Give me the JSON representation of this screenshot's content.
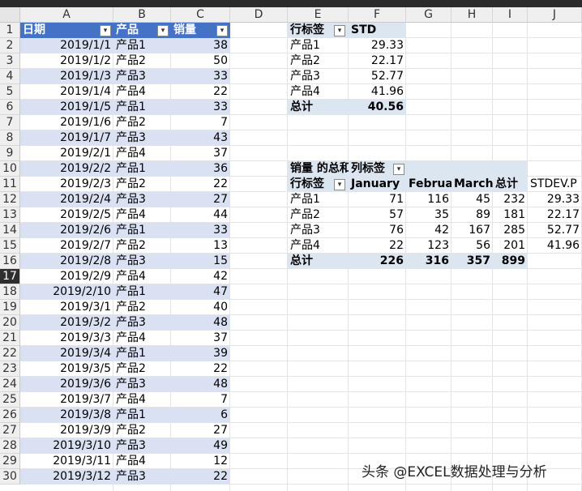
{
  "columns": [
    "A",
    "B",
    "C",
    "D",
    "E",
    "F",
    "G",
    "H",
    "I",
    "J"
  ],
  "rows": [
    "1",
    "2",
    "3",
    "4",
    "5",
    "6",
    "7",
    "8",
    "9",
    "10",
    "11",
    "12",
    "13",
    "14",
    "15",
    "16",
    "17",
    "18",
    "19",
    "20",
    "21",
    "22",
    "23",
    "24",
    "25",
    "26",
    "27",
    "28",
    "29",
    "30"
  ],
  "selected_row": "17",
  "table": {
    "headers": [
      "日期",
      "产品",
      "销量"
    ],
    "rows": [
      [
        "2019/1/1",
        "产品1",
        "38"
      ],
      [
        "2019/1/2",
        "产品2",
        "50"
      ],
      [
        "2019/1/3",
        "产品3",
        "33"
      ],
      [
        "2019/1/4",
        "产品4",
        "22"
      ],
      [
        "2019/1/5",
        "产品1",
        "33"
      ],
      [
        "2019/1/6",
        "产品2",
        "7"
      ],
      [
        "2019/1/7",
        "产品3",
        "43"
      ],
      [
        "2019/2/1",
        "产品4",
        "37"
      ],
      [
        "2019/2/2",
        "产品1",
        "36"
      ],
      [
        "2019/2/3",
        "产品2",
        "22"
      ],
      [
        "2019/2/4",
        "产品3",
        "27"
      ],
      [
        "2019/2/5",
        "产品4",
        "44"
      ],
      [
        "2019/2/6",
        "产品1",
        "33"
      ],
      [
        "2019/2/7",
        "产品2",
        "13"
      ],
      [
        "2019/2/8",
        "产品3",
        "15"
      ],
      [
        "2019/2/9",
        "产品4",
        "42"
      ],
      [
        "2019/2/10",
        "产品1",
        "47"
      ],
      [
        "2019/3/1",
        "产品2",
        "40"
      ],
      [
        "2019/3/2",
        "产品3",
        "48"
      ],
      [
        "2019/3/3",
        "产品4",
        "37"
      ],
      [
        "2019/3/4",
        "产品1",
        "39"
      ],
      [
        "2019/3/5",
        "产品2",
        "22"
      ],
      [
        "2019/3/6",
        "产品3",
        "48"
      ],
      [
        "2019/3/7",
        "产品4",
        "7"
      ],
      [
        "2019/3/8",
        "产品1",
        "6"
      ],
      [
        "2019/3/9",
        "产品2",
        "27"
      ],
      [
        "2019/3/10",
        "产品3",
        "49"
      ],
      [
        "2019/3/11",
        "产品4",
        "12"
      ],
      [
        "2019/3/12",
        "产品3",
        "22"
      ]
    ]
  },
  "pivot1": {
    "header_row_label": "行标签",
    "header_value": "STD",
    "rows": [
      [
        "产品1",
        "29.33"
      ],
      [
        "产品2",
        "22.17"
      ],
      [
        "产品3",
        "52.77"
      ],
      [
        "产品4",
        "41.96"
      ]
    ],
    "total_label": "总计",
    "total_value": "40.56"
  },
  "pivot2": {
    "value_label": "销量 的总和",
    "col_label": "列标签",
    "row_label": "行标签",
    "col_headers": [
      "January",
      "February",
      "March",
      "总计"
    ],
    "extra_header": "STDEV.P",
    "rows": [
      [
        "产品1",
        "71",
        "116",
        "45",
        "232",
        "29.33"
      ],
      [
        "产品2",
        "57",
        "35",
        "89",
        "181",
        "22.17"
      ],
      [
        "产品3",
        "76",
        "42",
        "167",
        "285",
        "52.77"
      ],
      [
        "产品4",
        "22",
        "123",
        "56",
        "201",
        "41.96"
      ]
    ],
    "total_row": [
      "总计",
      "226",
      "316",
      "357",
      "899"
    ]
  },
  "watermark": "头条 @EXCEL数据处理与分析",
  "colors": {
    "table_header": "#4472c4",
    "band": "#d9e1f2",
    "pivot_header": "#dce6f1"
  }
}
